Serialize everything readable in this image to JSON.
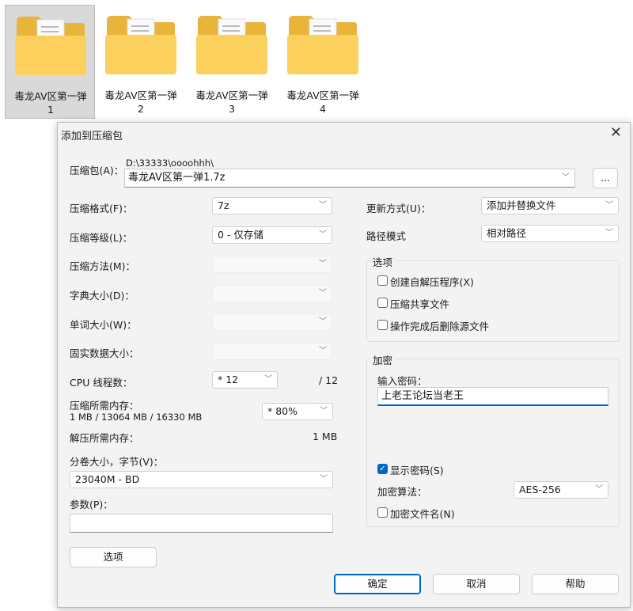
{
  "desktop": {
    "files": [
      {
        "name": "毒龙AV区第一弹",
        "num": "1"
      },
      {
        "name": "毒龙AV区第一弹",
        "num": "2"
      },
      {
        "name": "毒龙AV区第一弹",
        "num": "3"
      },
      {
        "name": "毒龙AV区第一弹",
        "num": "4"
      }
    ]
  },
  "dialog": {
    "title": "添加到压缩包",
    "archive_label": "压缩包(A)：",
    "archive_path": "D:\\33333\\oooohhh\\",
    "archive_name": "毒龙AV区第一弹1.7z",
    "browse": "...",
    "format_label": "压缩格式(F)：",
    "format": "7z",
    "level_label": "压缩等级(L)：",
    "level": "0 - 仅存储",
    "method_label": "压缩方法(M)：",
    "dict_label": "字典大小(D)：",
    "word_label": "单词大小(W)：",
    "solid_label": "固实数据大小：",
    "cpu_label": "CPU 线程数：",
    "cpu": "* 12",
    "cpu_max": "/ 12",
    "mem_label": "压缩所需内存：",
    "mem_values": "1 MB / 13064 MB / 16330 MB",
    "mem_pct": "* 80%",
    "decomp_label": "解压所需内存：",
    "decomp": "1 MB",
    "split_label": "分卷大小，字节(V)：",
    "split": "23040M - BD",
    "params_label": "参数(P)：",
    "params": "",
    "options_button": "选项",
    "update_label": "更新方式(U)：",
    "update": "添加并替换文件",
    "path_label": "路径模式",
    "path": "相对路径",
    "options_group": "选项",
    "opt_sfx": "创建自解压程序(X)",
    "opt_shared": "压缩共享文件",
    "opt_delete": "操作完成后删除源文件",
    "enc_group": "加密",
    "pwd_label": "输入密码：",
    "password": "上老王论坛当老王",
    "show_pwd": "显示密码(S)",
    "enc_method_label": "加密算法：",
    "enc_method": "AES-256",
    "enc_names": "加密文件名(N)",
    "ok": "确定",
    "cancel": "取消",
    "help": "帮助"
  }
}
